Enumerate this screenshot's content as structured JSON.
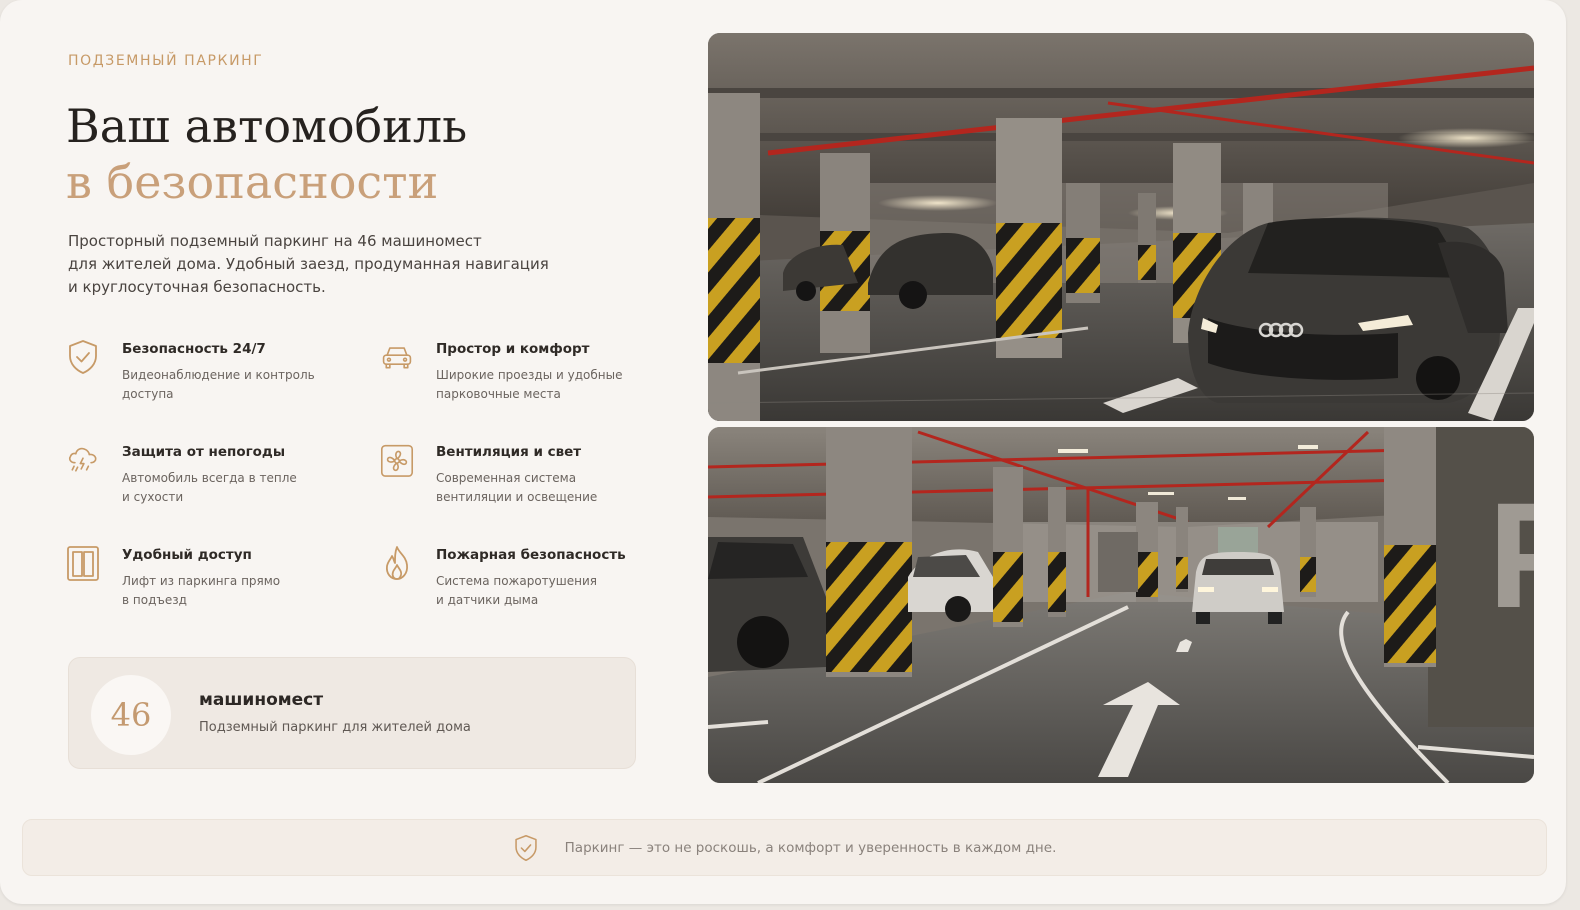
{
  "header": {
    "eyebrow": "ПОДЗЕМНЫЙ ПАРКИНГ",
    "title_line1": "Ваш автомобиль",
    "title_line2": "в безопасности"
  },
  "lead": {
    "line1": "Просторный подземный паркинг на 46 машиномест",
    "line2": "для жителей дома. Удобный заезд, продуманная навигация",
    "line3": "и круглосуточная безопасность."
  },
  "features": [
    {
      "icon": "shield-check-icon",
      "title": "Безопасность 24/7",
      "desc1": "Видеонаблюдение и контроль",
      "desc2": "доступа"
    },
    {
      "icon": "car-icon",
      "title": "Простор и комфорт",
      "desc1": "Широкие проезды и удобные",
      "desc2": "парковочные места"
    },
    {
      "icon": "storm-cloud-icon",
      "title": "Защита от непогоды",
      "desc1": "Автомобиль всегда в тепле",
      "desc2": "и сухости"
    },
    {
      "icon": "fan-icon",
      "title": "Вентиляция и свет",
      "desc1": "Современная система",
      "desc2": "вентиляции и освещение"
    },
    {
      "icon": "elevator-icon",
      "title": "Удобный доступ",
      "desc1": "Лифт из паркинга прямо",
      "desc2": "в подъезд"
    },
    {
      "icon": "flame-icon",
      "title": "Пожарная безопасность",
      "desc1": "Система пожаротушения",
      "desc2": "и датчики дыма"
    }
  ],
  "stat": {
    "number": "46",
    "label": "машиномест",
    "sub": "Подземный паркинг для жителей дома"
  },
  "photos": {
    "top_photo": "underground-parking-photo-audi",
    "bottom_photo": "underground-parking-photo-driveway"
  },
  "footer": {
    "icon": "shield-check-icon",
    "text": "Паркинг — это не роскошь, а комфорт и уверенность в каждом дне."
  },
  "colors": {
    "accent": "#c79a67",
    "title_accent": "#c9a07a",
    "background": "#f8f5f2",
    "hazard_yellow": "#c9a021",
    "pipe_red": "#b3261e"
  }
}
